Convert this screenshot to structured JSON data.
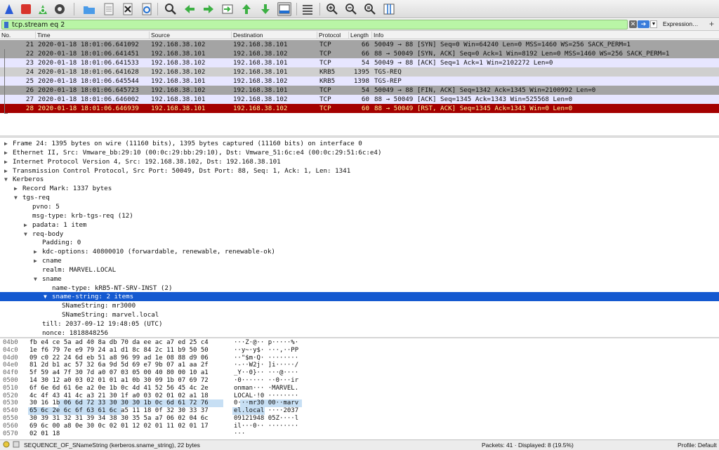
{
  "toolbar": {
    "icons": [
      "shark-fin-start-icon",
      "stop-square-icon",
      "restart-fin-icon",
      "gear-icon",
      "folder-icon",
      "file-icon",
      "close-file-icon",
      "reload-icon",
      "search-icon",
      "arrow-left-icon",
      "arrow-right-icon",
      "jump-icon",
      "arrow-up-icon",
      "arrow-down-icon",
      "autoscroll-icon",
      "colorize-icon",
      "zoom-in-icon",
      "zoom-out-icon",
      "zoom-reset-icon",
      "resize-columns-icon"
    ]
  },
  "filter": {
    "value": "tcp.stream eq 2",
    "expression_label": "Expression…",
    "plus_label": "+"
  },
  "packet_list": {
    "columns": [
      "No.",
      "Time",
      "Source",
      "Destination",
      "Protocol",
      "Length",
      "Info"
    ],
    "rows": [
      {
        "no": "21",
        "time": "2020-01-18 18:01:06.641092",
        "src": "192.168.38.102",
        "dst": "192.168.38.101",
        "proto": "TCP",
        "len": "66",
        "info": "50049 → 88 [SYN] Seq=0 Win=64240 Len=0 MSS=1460 WS=256 SACK_PERM=1",
        "bg": "#a4a4a4",
        "fg": "#111111"
      },
      {
        "no": "22",
        "time": "2020-01-18 18:01:06.641451",
        "src": "192.168.38.101",
        "dst": "192.168.38.102",
        "proto": "TCP",
        "len": "66",
        "info": "88 → 50049 [SYN, ACK] Seq=0 Ack=1 Win=8192 Len=0 MSS=1460 WS=256 SACK_PERM=1",
        "bg": "#a4a4a4",
        "fg": "#111111"
      },
      {
        "no": "23",
        "time": "2020-01-18 18:01:06.641533",
        "src": "192.168.38.102",
        "dst": "192.168.38.101",
        "proto": "TCP",
        "len": "54",
        "info": "50049 → 88 [ACK] Seq=1 Ack=1 Win=2102272 Len=0",
        "bg": "#e7e6ff",
        "fg": "#111111"
      },
      {
        "no": "24",
        "time": "2020-01-18 18:01:06.641628",
        "src": "192.168.38.102",
        "dst": "192.168.38.101",
        "proto": "KRB5",
        "len": "1395",
        "info": "TGS-REQ",
        "bg": "#cfcfcf",
        "fg": "#111111"
      },
      {
        "no": "25",
        "time": "2020-01-18 18:01:06.645544",
        "src": "192.168.38.101",
        "dst": "192.168.38.102",
        "proto": "KRB5",
        "len": "1398",
        "info": "TGS-REP",
        "bg": "#e7e6ff",
        "fg": "#111111"
      },
      {
        "no": "26",
        "time": "2020-01-18 18:01:06.645723",
        "src": "192.168.38.102",
        "dst": "192.168.38.101",
        "proto": "TCP",
        "len": "54",
        "info": "50049 → 88 [FIN, ACK] Seq=1342 Ack=1345 Win=2100992 Len=0",
        "bg": "#a4a4a4",
        "fg": "#111111"
      },
      {
        "no": "27",
        "time": "2020-01-18 18:01:06.646002",
        "src": "192.168.38.101",
        "dst": "192.168.38.102",
        "proto": "TCP",
        "len": "60",
        "info": "88 → 50049 [ACK] Seq=1345 Ack=1343 Win=525568 Len=0",
        "bg": "#e7e6ff",
        "fg": "#111111"
      },
      {
        "no": "28",
        "time": "2020-01-18 18:01:06.646939",
        "src": "192.168.38.101",
        "dst": "192.168.38.102",
        "proto": "TCP",
        "len": "60",
        "info": "88 → 50049 [RST, ACK] Seq=1345 Ack=1343 Win=0 Len=0",
        "bg": "#a40000",
        "fg": "#fffc9c"
      }
    ]
  },
  "details": [
    {
      "indent": 0,
      "tri": "▶",
      "text": "Frame 24: 1395 bytes on wire (11160 bits), 1395 bytes captured (11160 bits) on interface 0"
    },
    {
      "indent": 0,
      "tri": "▶",
      "text": "Ethernet II, Src: Vmware_bb:29:10 (00:0c:29:bb:29:10), Dst: Vmware_51:6c:e4 (00:0c:29:51:6c:e4)"
    },
    {
      "indent": 0,
      "tri": "▶",
      "text": "Internet Protocol Version 4, Src: 192.168.38.102, Dst: 192.168.38.101"
    },
    {
      "indent": 0,
      "tri": "▶",
      "text": "Transmission Control Protocol, Src Port: 50049, Dst Port: 88, Seq: 1, Ack: 1, Len: 1341"
    },
    {
      "indent": 0,
      "tri": "▼",
      "text": "Kerberos"
    },
    {
      "indent": 1,
      "tri": "▶",
      "text": "Record Mark: 1337 bytes"
    },
    {
      "indent": 1,
      "tri": "▼",
      "text": "tgs-req"
    },
    {
      "indent": 2,
      "tri": "",
      "text": "pvno: 5"
    },
    {
      "indent": 2,
      "tri": "",
      "text": "msg-type: krb-tgs-req (12)"
    },
    {
      "indent": 2,
      "tri": "▶",
      "text": "padata: 1 item"
    },
    {
      "indent": 2,
      "tri": "▼",
      "text": "req-body"
    },
    {
      "indent": 3,
      "tri": "",
      "text": "Padding: 0"
    },
    {
      "indent": 3,
      "tri": "▶",
      "text": "kdc-options: 40800010 (forwardable, renewable, renewable-ok)"
    },
    {
      "indent": 3,
      "tri": "▶",
      "text": "cname"
    },
    {
      "indent": 3,
      "tri": "",
      "text": "realm: MARVEL.LOCAL"
    },
    {
      "indent": 3,
      "tri": "▼",
      "text": "sname"
    },
    {
      "indent": 4,
      "tri": "",
      "text": "name-type: kRB5-NT-SRV-INST (2)"
    },
    {
      "indent": 4,
      "tri": "▼",
      "text": "sname-string: 2 items",
      "selected": true
    },
    {
      "indent": 5,
      "tri": "",
      "text": "SNameString: mr3000"
    },
    {
      "indent": 5,
      "tri": "",
      "text": "SNameString: marvel.local"
    },
    {
      "indent": 3,
      "tri": "",
      "text": "till: 2037-09-12 19:48:05 (UTC)"
    },
    {
      "indent": 3,
      "tri": "",
      "text": "nonce: 1818848256"
    }
  ],
  "bytes": [
    {
      "off": "04b0",
      "hex": "fb e4 ce 5a ad 40 8a db  70 da ee ac a7 ed 25 c4",
      "ascii": "···Z·@··  p·····%·"
    },
    {
      "off": "04c0",
      "hex": "1e f6 79 7e e9 79 24 a1  d1 8c 84 2c 11 b9 50 50",
      "ascii": "··y~·y$·  ···,··PP"
    },
    {
      "off": "04d0",
      "hex": "09 c0 22 24 6d eb 51 a8  96 99 ad 1e 08 88 d9 06",
      "ascii": "··\"$m·Q·  ········"
    },
    {
      "off": "04e0",
      "hex": "81 2d b1 ac 57 32 6a 9d  5d 69 e7 9b 07 a1 aa 2f",
      "ascii": "·-··W2j·  ]i·····/"
    },
    {
      "off": "04f0",
      "hex": "5f 59 a4 7f 30 7d a0 07  03 05 00 40 80 00 10 a1",
      "ascii": "_Y··0}··  ···@····"
    },
    {
      "off": "0500",
      "hex": "14 30 12 a0 03 02 01 01  a1 0b 30 09 1b 07 69 72",
      "ascii": "·0······  ··0···ir"
    },
    {
      "off": "0510",
      "hex": "6f 6e 6d 61 6e a2 0e 1b  0c 4d 41 52 56 45 4c 2e",
      "ascii": "onman···  ·MARVEL."
    },
    {
      "off": "0520",
      "hex": "4c 4f 43 41 4c a3 21 30  1f a0 03 02 01 02 a1 18",
      "ascii": "LOCAL·!0  ········"
    },
    {
      "off": "0530",
      "hex": "30 16 1b 06 6d 72 33 30  30 30 1b 0c 6d 61 72 76",
      "ascii": "0···mr30  00··marv"
    },
    {
      "off": "0540",
      "hex": "65 6c 2e 6c 6f 63 61 6c  a5 11 18 0f 32 30 33 37",
      "ascii": "el.local  ····2037"
    },
    {
      "off": "0550",
      "hex": "30 39 31 32 31 39 34 38  30 35 5a a7 06 02 04 6c",
      "ascii": "09121948  05Z····l"
    },
    {
      "off": "0560",
      "hex": "69 6c 00 a8 0e 30 0c 02  01 12 02 01 11 02 01 17",
      "ascii": "il···0··  ········"
    },
    {
      "off": "0570",
      "hex": "02 01 18",
      "ascii": "···"
    }
  ],
  "status": {
    "field_info": "SEQUENCE_OF_SNameString (kerberos.sname_string), 22 bytes",
    "packets": "Packets: 41 · Displayed: 8 (19.5%)",
    "profile": "Profile: Default"
  }
}
